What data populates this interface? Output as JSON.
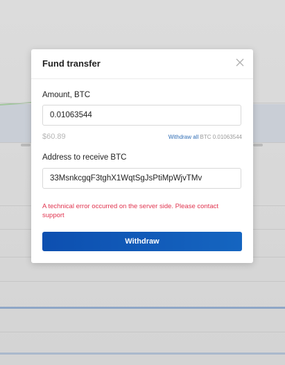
{
  "modal": {
    "title": "Fund transfer",
    "amount_label": "Amount, BTC",
    "amount_value": "0.01063544",
    "fiat_value": "$60.89",
    "withdraw_all_label": "Withdraw all",
    "withdraw_all_amount": "BTC 0.01063544",
    "address_label": "Address to receive BTC",
    "address_value": "33MsnkcgqF3tghX1WqtSgJsPtiMpWjvTMv",
    "error_message": "A technical error occurred on the server side. Please contact support",
    "withdraw_button_label": "Withdraw"
  },
  "icons": {
    "close": "close-icon"
  },
  "colors": {
    "primary_button": "#1158b8",
    "error": "#e0344f",
    "link": "#2f6db5"
  }
}
